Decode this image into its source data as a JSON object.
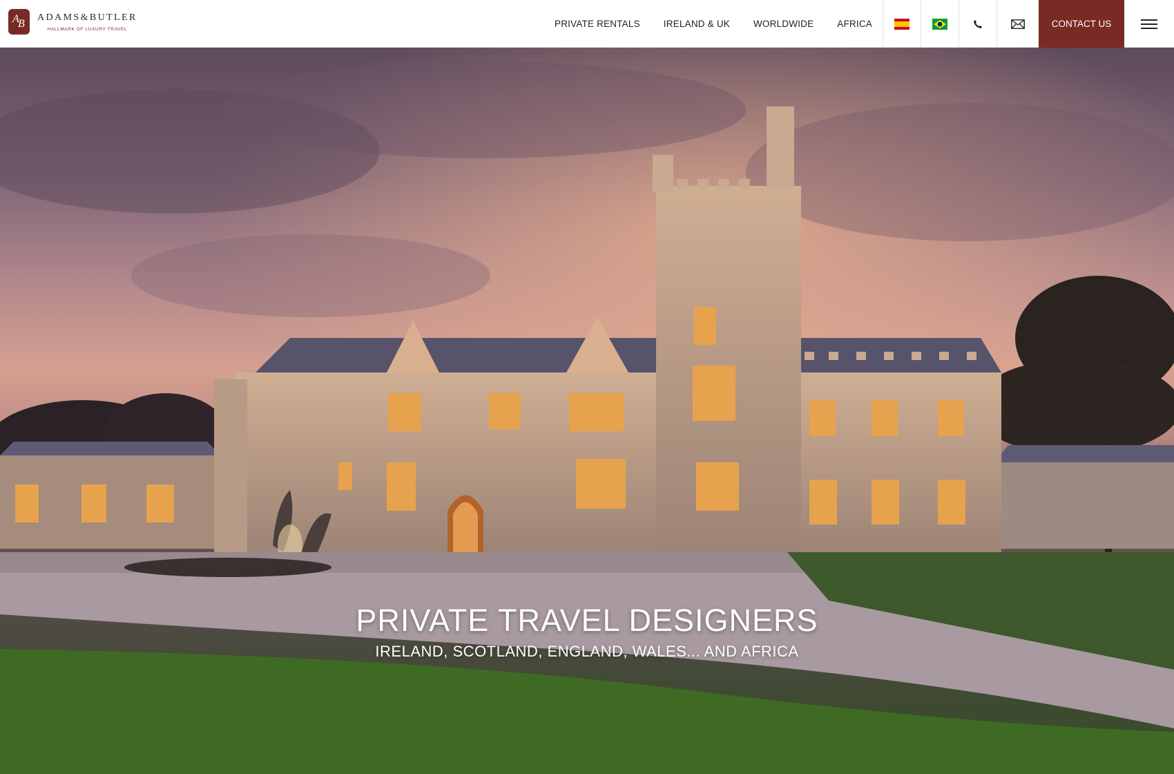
{
  "brand": {
    "name": "ADAMS&BUTLER",
    "tagline": "HALLMARK OF LUXURY TRAVEL"
  },
  "nav": {
    "links": [
      "PRIVATE RENTALS",
      "IRELAND & UK",
      "WORLDWIDE",
      "AFRICA"
    ],
    "contact_label": "CONTACT US",
    "icons": [
      "spain-flag-icon",
      "brazil-flag-icon",
      "phone-icon",
      "mail-icon",
      "hamburger-menu-icon"
    ]
  },
  "hero": {
    "title": "PRIVATE TRAVEL DESIGNERS",
    "subtitle": "IRELAND, SCOTLAND, ENGLAND, WALES... AND AFRICA"
  },
  "colors": {
    "brand": "#7a2a25"
  }
}
